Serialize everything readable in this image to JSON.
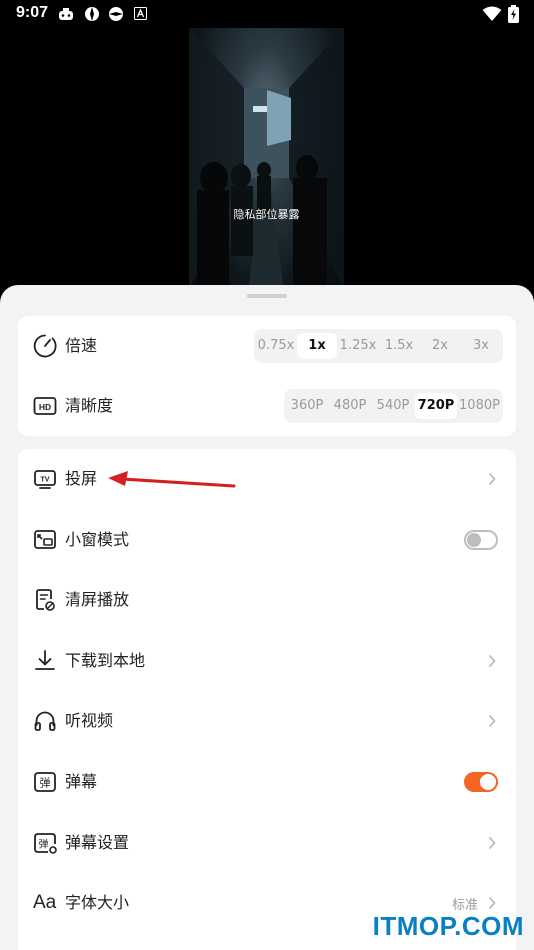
{
  "status_bar": {
    "time": "9:07"
  },
  "video": {
    "subtitle": "隐私部位暴露"
  },
  "playback_card": {
    "speed": {
      "label": "倍速",
      "options": [
        "0.75x",
        "1x",
        "1.25x",
        "1.5x",
        "2x",
        "3x"
      ],
      "selected": "1x"
    },
    "quality": {
      "label": "清晰度",
      "options": [
        "360P",
        "480P",
        "540P",
        "720P",
        "1080P"
      ],
      "selected": "720P"
    }
  },
  "menu": {
    "cast": "投屏",
    "pip": "小窗模式",
    "pip_enabled": false,
    "clear_screen": "清屏播放",
    "download": "下载到本地",
    "audio_only": "听视频",
    "danmaku": "弹幕",
    "danmaku_enabled": true,
    "danmaku_settings": "弹幕设置",
    "font_size": "字体大小",
    "font_size_icon_text": "Aa",
    "font_size_value": "标准"
  },
  "colors": {
    "accent": "#f26522",
    "annotation_arrow": "#d42020",
    "watermark": "#0a7fc4"
  },
  "watermark": "ITMOP.COM"
}
